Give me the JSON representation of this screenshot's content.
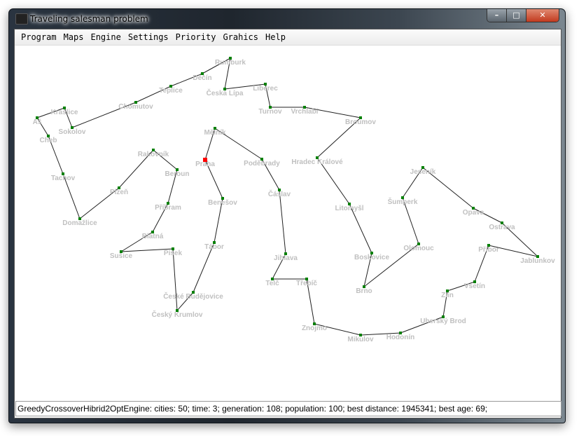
{
  "window": {
    "title": "Traveling salesman problem",
    "controls": {
      "minimize": "–",
      "maximize": "□",
      "close": "✕"
    }
  },
  "menu": [
    {
      "label": "Program"
    },
    {
      "label": "Maps"
    },
    {
      "label": "Engine"
    },
    {
      "label": "Settings"
    },
    {
      "label": "Priority"
    },
    {
      "label": "Grahics"
    },
    {
      "label": "Help"
    }
  ],
  "map": {
    "start_city": "Praha",
    "colors": {
      "city": "#008000",
      "start": "#ff0000",
      "route": "#202020",
      "label": "#c0c0c0"
    },
    "tour": [
      "Rumburk",
      "Děčín",
      "Teplice",
      "Chomutov",
      "Sokolov",
      "Kraslice",
      "Aš",
      "Cheb",
      "Tachov",
      "Domažlice",
      "Plzeň",
      "Rakovník",
      "Beroun",
      "Příbram",
      "Blatná",
      "Sušice",
      "Písek",
      "Český Krumlov",
      "České Budějovice",
      "Tábor",
      "Benešov",
      "Praha",
      "Mělník",
      "Poděbrady",
      "Čáslav",
      "Jihlava",
      "Telč",
      "Třebíč",
      "Znojmo",
      "Mikulov",
      "Hodonín",
      "Uherský Brod",
      "Zlín",
      "Vsetín",
      "Příbor",
      "Jablunkov",
      "Ostrava",
      "Opava",
      "Jeseník",
      "Šumperk",
      "Olomouc",
      "Brno",
      "Boskovice",
      "Litomyšl",
      "Hradec Králové",
      "Broumov",
      "Vrchlabí",
      "Turnov",
      "Liberec",
      "Česká Lípa"
    ]
  },
  "status": {
    "text": "GreedyCrossoverHibrid2OptEngine: cities: 50; time: 3; generation: 108; population: 100; best distance: 1945341; best age: 69;"
  }
}
